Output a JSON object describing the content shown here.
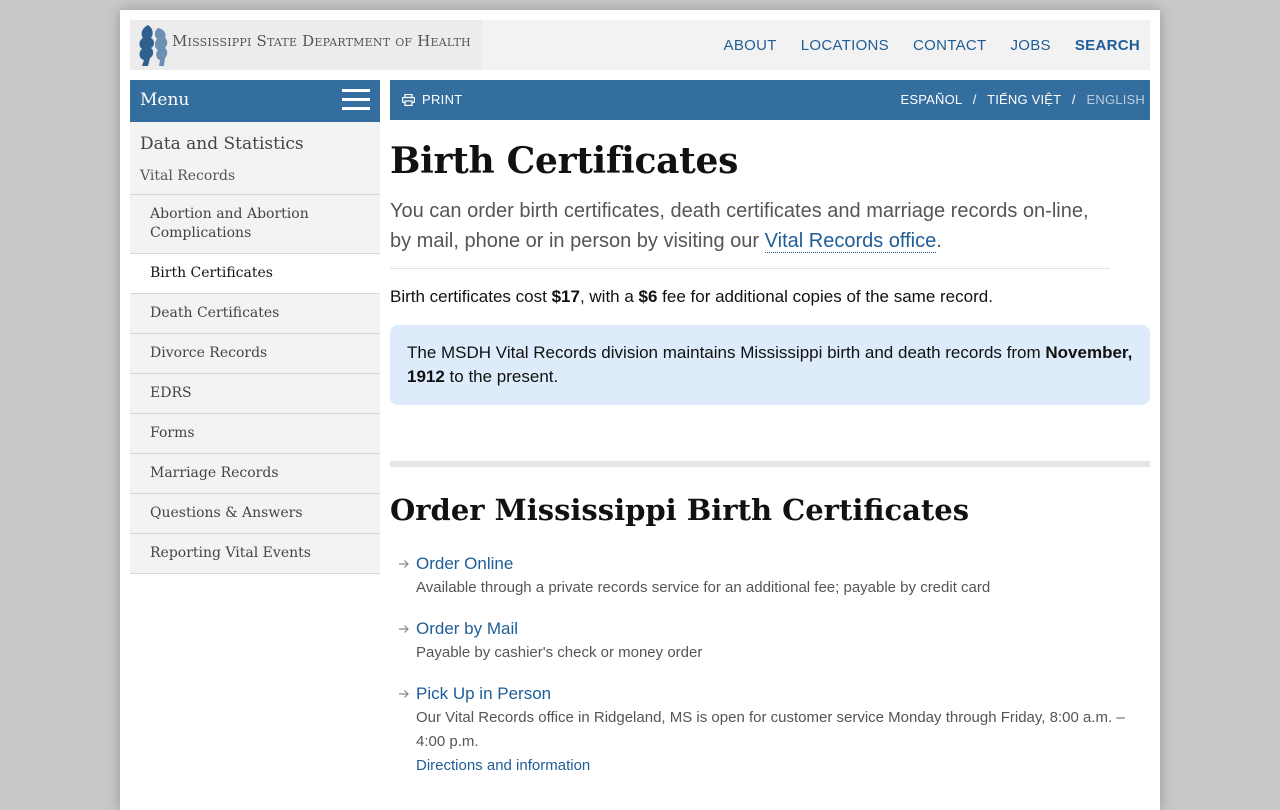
{
  "header": {
    "logo_text_1": "Mississippi State Department of Health",
    "nav": {
      "about": "ABOUT",
      "locations": "LOCATIONS",
      "contact": "CONTACT",
      "jobs": "JOBS",
      "search": "SEARCH"
    }
  },
  "sidebar": {
    "menu_label": "Menu",
    "heading": "Data and Statistics",
    "sub_heading": "Vital Records",
    "items": [
      "Abortion and Abortion Complications",
      "Birth Certificates",
      "Death Certificates",
      "Divorce Records",
      "EDRS",
      "Forms",
      "Marriage Records",
      "Questions & Answers",
      "Reporting Vital Events"
    ],
    "active_item": "Birth Certificates"
  },
  "toolbar": {
    "print_label": "PRINT",
    "languages": [
      "ESPAÑOL",
      "TIẾNG VIỆT",
      "ENGLISH"
    ],
    "separator": "/"
  },
  "main": {
    "title": "Birth Certificates",
    "lead_text": "You can order birth certificates, death certificates and marriage records on-line, by mail, phone or in person by visiting our",
    "lead_link": "Vital Records office",
    "lead_end": ".",
    "price_prefix": "Birth certificates cost ",
    "price_main": "$17",
    "price_mid": ", with a ",
    "price_fee": "$6",
    "price_suffix": " fee for additional copies of the same record.",
    "notice_text": "The MSDH Vital Records division maintains Mississippi birth and death records from ",
    "notice_date": "November, 1912",
    "notice_end": " to the present.",
    "section_title": "Order Mississippi Birth Certificates",
    "options": [
      {
        "title": "Order Online",
        "desc": "Available through a private records service for an additional fee; payable by credit card"
      },
      {
        "title": "Order by Mail",
        "desc": "Payable by cashier's check or money order"
      },
      {
        "title": "Pick Up in Person",
        "desc": "Our Vital Records office in Ridgeland, MS is open for customer service Monday through Friday, 8:00 a.m. – 4:00 p.m.",
        "more": "Directions and information"
      }
    ]
  },
  "colors": {
    "brand_blue": "#336e9e",
    "link_blue": "#1f5d96",
    "notice_bg": "#ddebfa"
  }
}
